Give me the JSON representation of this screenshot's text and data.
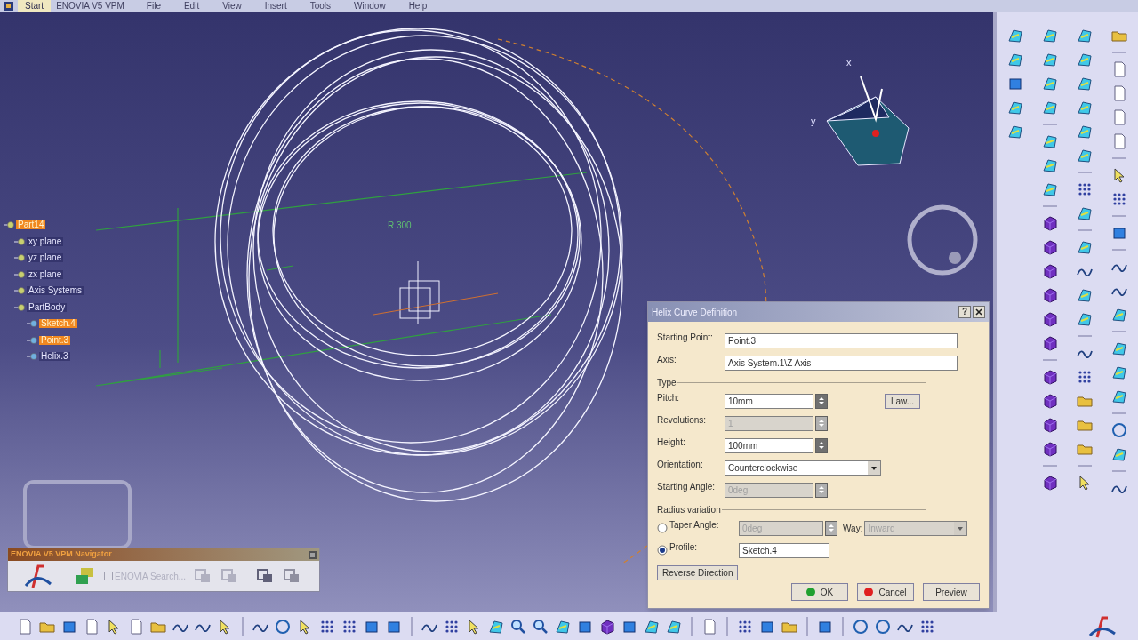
{
  "menu_bar": {
    "start": "Start",
    "items": [
      "ENOVIA V5 VPM",
      "File",
      "Edit",
      "View",
      "Insert",
      "Tools",
      "Window",
      "Help"
    ]
  },
  "tree": {
    "label": "Part14",
    "selected": true,
    "children": [
      {
        "label": "xy plane",
        "selected": false
      },
      {
        "label": "yz plane",
        "selected": false
      },
      {
        "label": "zx plane",
        "selected": false
      },
      {
        "label": "Axis Systems",
        "selected": false
      },
      {
        "label": "PartBody",
        "selected": false,
        "children": [
          {
            "label": "Sketch.4",
            "selected": true
          },
          {
            "label": "Point.3",
            "selected": true
          },
          {
            "label": "Helix.3",
            "selected": false
          }
        ]
      }
    ]
  },
  "viewport": {
    "dimension_label": "R 300",
    "axis_labels": [
      "x",
      "y"
    ]
  },
  "dialog": {
    "title": "Helix Curve Definition",
    "help_button": "?",
    "rows": [
      {
        "kind": "text",
        "label": "Starting Point:",
        "value": "Point.3"
      },
      {
        "kind": "text",
        "label": "Axis:",
        "value": "Axis System.1\\Z Axis"
      },
      {
        "kind": "section",
        "label": "Type"
      },
      {
        "kind": "spin",
        "label": "Pitch:",
        "value": "10mm",
        "disabled": false,
        "button": "Law..."
      },
      {
        "kind": "spin",
        "label": "Revolutions:",
        "value": "1",
        "disabled": true
      },
      {
        "kind": "spin",
        "label": "Height:",
        "value": "100mm",
        "disabled": false
      },
      {
        "kind": "combo",
        "label": "Orientation:",
        "value": "Counterclockwise",
        "disabled": false
      },
      {
        "kind": "spin",
        "label": "Starting Angle:",
        "value": "0deg",
        "disabled": true
      },
      {
        "kind": "section",
        "label": "Radius variation"
      },
      {
        "kind": "radio_spin",
        "label": "Taper Angle:",
        "value": "0deg",
        "disabled": true,
        "selected": false,
        "way_label": "Way:",
        "way_value": "Inward"
      },
      {
        "kind": "radio_text",
        "label": "Profile:",
        "value": "Sketch.4",
        "selected": true
      },
      {
        "kind": "button",
        "label": "Reverse Direction"
      }
    ],
    "buttons": [
      {
        "kind": "ok",
        "label": "OK"
      },
      {
        "kind": "cancel",
        "label": "Cancel"
      },
      {
        "kind": "plain",
        "label": "Preview"
      }
    ]
  },
  "navigator": {
    "title": "ENOVIA V5 VPM Navigator",
    "search_label": "ENOVIA Search...",
    "search_checked": false
  }
}
